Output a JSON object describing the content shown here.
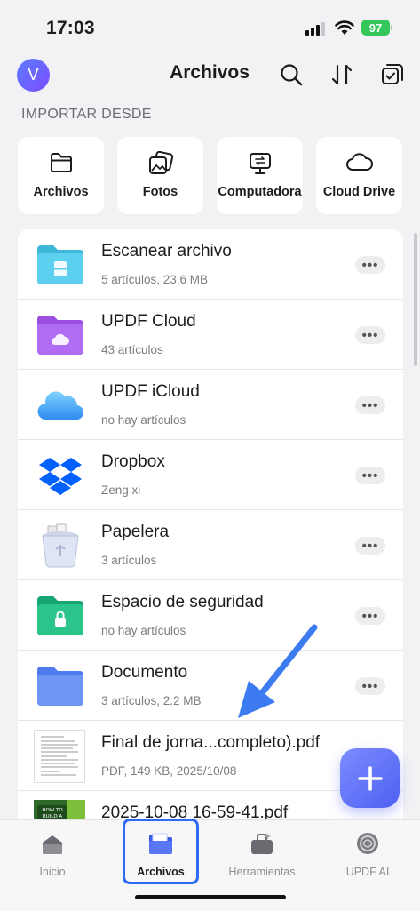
{
  "status_bar": {
    "time": "17:03",
    "battery": "97"
  },
  "header": {
    "avatar_letter": "V",
    "title": "Archivos"
  },
  "import": {
    "section_label": "IMPORTAR DESDE",
    "sources": [
      {
        "label": "Archivos",
        "icon": "folder-icon"
      },
      {
        "label": "Fotos",
        "icon": "photos-icon"
      },
      {
        "label": "Computadora",
        "icon": "computer-icon"
      },
      {
        "label": "Cloud Drive",
        "icon": "cloud-icon"
      }
    ]
  },
  "list": {
    "items": [
      {
        "name": "Escanear archivo",
        "meta": "5 artículos, 23.6 MB",
        "icon": "scan-folder-icon"
      },
      {
        "name": "UPDF Cloud",
        "meta": "43 artículos",
        "icon": "updf-cloud-folder-icon"
      },
      {
        "name": "UPDF iCloud",
        "meta": "no hay artículos",
        "icon": "icloud-icon"
      },
      {
        "name": "Dropbox",
        "meta": "Zeng xi",
        "icon": "dropbox-icon"
      },
      {
        "name": "Papelera",
        "meta": "3 artículos",
        "icon": "trash-icon"
      },
      {
        "name": "Espacio de seguridad",
        "meta": "no hay artículos",
        "icon": "security-folder-icon"
      },
      {
        "name": "Documento",
        "meta": "3 artículos, 2.2 MB",
        "icon": "document-folder-icon"
      },
      {
        "name": "Final de jorna...completo).pdf",
        "meta": "PDF, 149 KB, 2025/10/08",
        "icon": "pdf-thumbnail"
      },
      {
        "name": "2025-10-08 16-59-41.pdf",
        "meta": "",
        "icon": "pdf-thumbnail"
      }
    ],
    "more_label": "•••"
  },
  "fab": {
    "label": "+"
  },
  "tabs": [
    {
      "label": "Inicio",
      "icon": "home-icon",
      "active": false
    },
    {
      "label": "Archivos",
      "icon": "files-icon",
      "active": true
    },
    {
      "label": "Herramientas",
      "icon": "tools-icon",
      "active": false
    },
    {
      "label": "UPDF AI",
      "icon": "ai-icon",
      "active": false
    }
  ],
  "colors": {
    "accent": "#4E61F2",
    "highlight": "#2F6BF2",
    "battery": "#34C759"
  }
}
